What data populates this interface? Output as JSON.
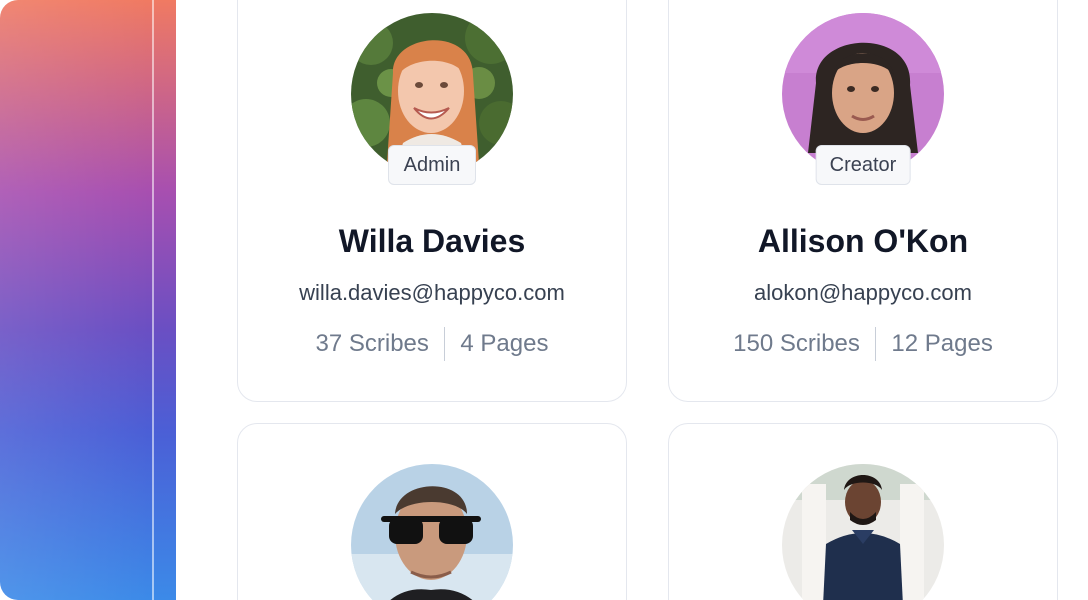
{
  "sidebar": {
    "accent_top": "#f07a62",
    "accent_bottom": "#3c8ae8"
  },
  "users": [
    {
      "role": "Admin",
      "name": "Willa Davies",
      "email": "willa.davies@happyco.com",
      "scribes": "37 Scribes",
      "pages": "4 Pages",
      "avatar_icon": "avatar-photo-woman-red-hair"
    },
    {
      "role": "Creator",
      "name": "Allison O'Kon",
      "email": "alokon@happyco.com",
      "scribes": "150 Scribes",
      "pages": "12 Pages",
      "avatar_icon": "avatar-photo-woman-dark-hair"
    },
    {
      "avatar_icon": "avatar-photo-man-sunglasses"
    },
    {
      "avatar_icon": "avatar-photo-man-navy-polo"
    }
  ]
}
